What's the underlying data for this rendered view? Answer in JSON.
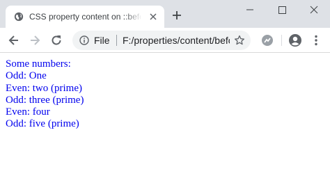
{
  "browser": {
    "tab": {
      "title": "CSS property content on ::before and ::after",
      "favicon": "globe-icon"
    },
    "address_bar": {
      "scheme_label": "File",
      "url": "F:/properties/content/before-after.html"
    },
    "icons": {
      "back": "back-arrow-icon",
      "forward": "forward-arrow-icon",
      "reload": "reload-icon",
      "info": "info-icon",
      "bookmark": "star-icon",
      "extension": "extension-icon",
      "profile": "profile-icon",
      "menu": "kebab-menu-icon"
    }
  },
  "page": {
    "heading": "Some numbers:",
    "lines": [
      "Odd: One",
      "Even: two (prime)",
      "Odd: three (prime)",
      "Even: four",
      "Odd: five (prime)"
    ]
  },
  "colors": {
    "text": "#0000ee",
    "titlebar": "#dee1e6",
    "omnibox": "#f1f3f4"
  }
}
